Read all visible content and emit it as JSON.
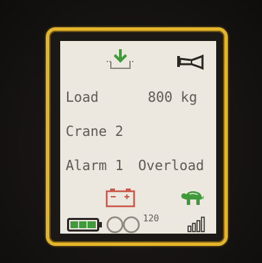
{
  "display": {
    "load_label": "Load",
    "load_value": "800 kg",
    "crane_label": "Crane 2",
    "alarm_label": "Alarm 1",
    "alarm_status": "Overload",
    "speed_value": "120"
  },
  "icons": {
    "top_left": "download-to-tray-icon",
    "top_right": "horn-icon",
    "battery_warning": "car-battery-icon",
    "turtle": "turtle-icon",
    "battery_level": "battery-level-icon",
    "rings": "double-circle-icon",
    "signal": "signal-bars-icon"
  },
  "battery": {
    "level": 1.0
  },
  "colors": {
    "frame": "#e3b52a",
    "green": "#3f9b3a",
    "battery_red": "#c9574a",
    "text": "#5e5a55",
    "background": "#ece8e0"
  }
}
